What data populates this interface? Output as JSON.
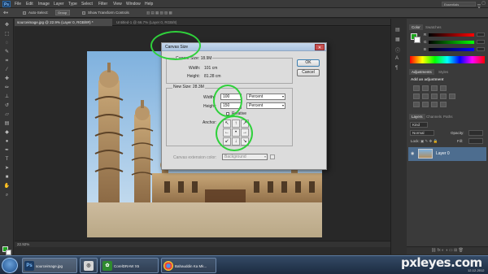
{
  "menubar": {
    "logo": "Ps",
    "items": [
      "File",
      "Edit",
      "Image",
      "Layer",
      "Type",
      "Select",
      "Filter",
      "View",
      "Window",
      "Help"
    ],
    "workspace": "Essentials"
  },
  "options": {
    "auto_select": "Auto-Select:",
    "group": "Group",
    "show_transform": "Show Transform Controls"
  },
  "tabs": {
    "doc1": "sourceimage.jpg @ 22.9% (Layer 0, RGB/8#) *",
    "doc2": "Untitled-1 @ 66.7% (Layer 0, RGB/8)"
  },
  "status": {
    "zoom": "22.92%"
  },
  "panels": {
    "color_tab": "Color",
    "swatches_tab": "Swatches",
    "labels": [
      "R",
      "G",
      "B"
    ],
    "adjustments_tab": "Adjustments",
    "styles_tab": "Styles",
    "add_adjustment": "Add an adjustment",
    "layers_tab": "Layers",
    "channels_tab": "Channels",
    "paths_tab": "Paths",
    "kind": "Kind",
    "normal": "Normal",
    "opacity": "Opacity:",
    "lock": "Lock:",
    "fill": "Fill:",
    "layer_name": "Layer 0"
  },
  "dialog": {
    "title": "Canvas Size",
    "current_size_label": "Current Size: 18.9M",
    "width_label": "Width:",
    "width_value": "101 cm",
    "height_label": "Height:",
    "height_value": "81.28 cm",
    "new_size_label": "New Size: 28.3M",
    "new_width_label": "Width:",
    "new_width_value": "100",
    "new_height_label": "Height:",
    "new_height_value": "150",
    "unit_width": "Percent",
    "unit_height": "Percent",
    "relative": "Relative",
    "anchor_label": "Anchor:",
    "extension_label": "Canvas extension color:",
    "extension_value": "Background",
    "ok": "OK",
    "cancel": "Cancel"
  },
  "taskbar": {
    "task1": "sourceimage.jpg",
    "task2": "CorelDRAW X5",
    "task3": "Bahauddin Ka Mk..."
  },
  "watermark": {
    "text": "pxleyes.com",
    "date": "12-12-2012"
  },
  "colors": {
    "highlight": "#2fd13b",
    "foreground": "#1da51d"
  },
  "icons": {
    "anchor_arrows": [
      "↖",
      "↑",
      "↗",
      "←",
      "•",
      "→",
      "↙",
      "↓",
      "↘"
    ]
  }
}
